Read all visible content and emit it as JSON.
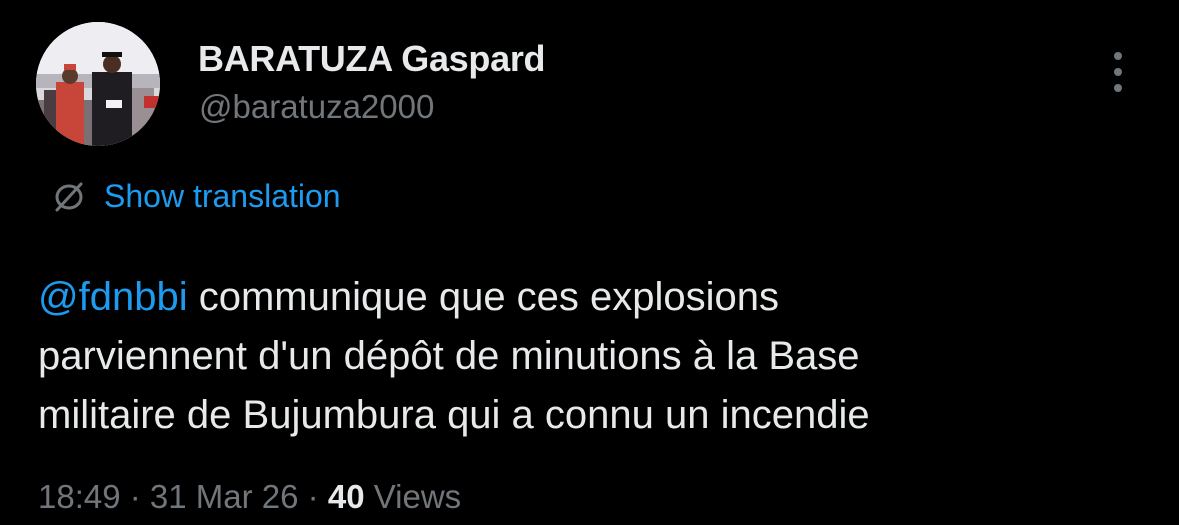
{
  "user": {
    "display_name": "BARATUZA Gaspard",
    "handle": "@baratuza2000"
  },
  "translation": {
    "label": "Show translation",
    "icon": "globe-icon"
  },
  "tweet": {
    "mention": "@fdnbbi",
    "line1": " communique que ces explosions",
    "line2": "parviennent d'un dépôt de minutions à la Base",
    "line3": "militaire de Bujumbura qui a connu un incendie"
  },
  "meta": {
    "time": "18:49",
    "separator": " · ",
    "date": "31 Mar 26",
    "views_count": "40",
    "views_label": " Views"
  },
  "colors": {
    "background": "#000000",
    "primary_text": "#e7e9ea",
    "secondary_text": "#71767b",
    "accent": "#1d9bf0"
  }
}
